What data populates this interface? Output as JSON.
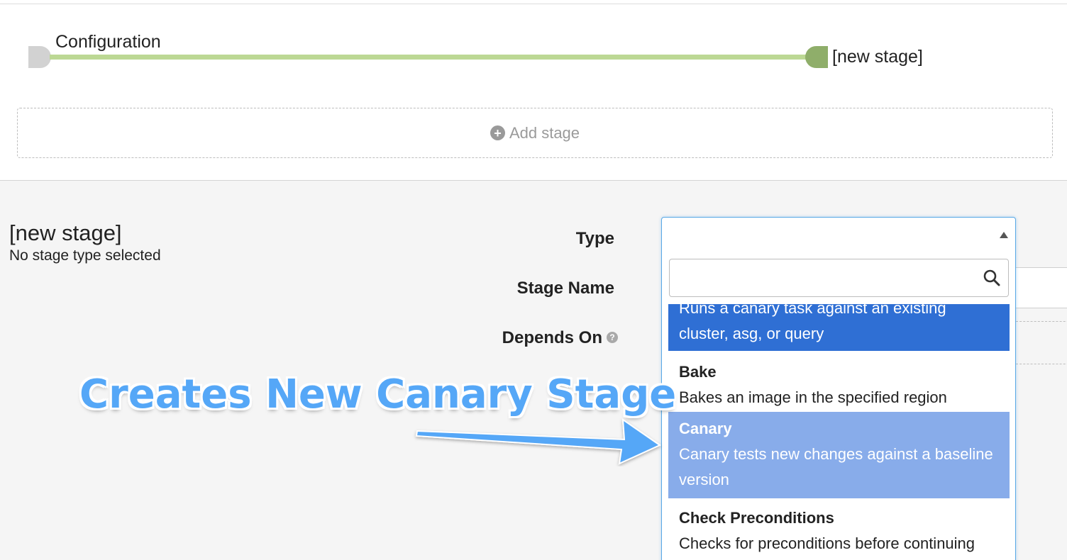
{
  "graph": {
    "start_label": "Configuration",
    "end_label": "[new stage]"
  },
  "add_stage": {
    "label": "Add stage"
  },
  "stage": {
    "title": "[new stage]",
    "subtitle": "No stage type selected"
  },
  "form": {
    "type_label": "Type",
    "stage_name_label": "Stage Name",
    "depends_on_label": "Depends On",
    "help_glyph": "?"
  },
  "dropdown": {
    "search_value": "",
    "options": [
      {
        "title": "",
        "description": "Runs a canary task against an existing cluster, asg, or query",
        "state": "active"
      },
      {
        "title": "Bake",
        "description": "Bakes an image in the specified region",
        "state": "normal"
      },
      {
        "title": "Canary",
        "description": "Canary tests new changes against a baseline version",
        "state": "hover"
      },
      {
        "title": "Check Preconditions",
        "description": "Checks for preconditions before continuing",
        "state": "normal"
      }
    ]
  },
  "annotation": {
    "text": "Creates New Canary Stage"
  },
  "colors": {
    "graph_line": "#bcd894",
    "graph_end_node": "#8fae6a",
    "active_option": "#2f6fd4",
    "hover_option": "#88acea",
    "annotation": "#55a7f7"
  }
}
